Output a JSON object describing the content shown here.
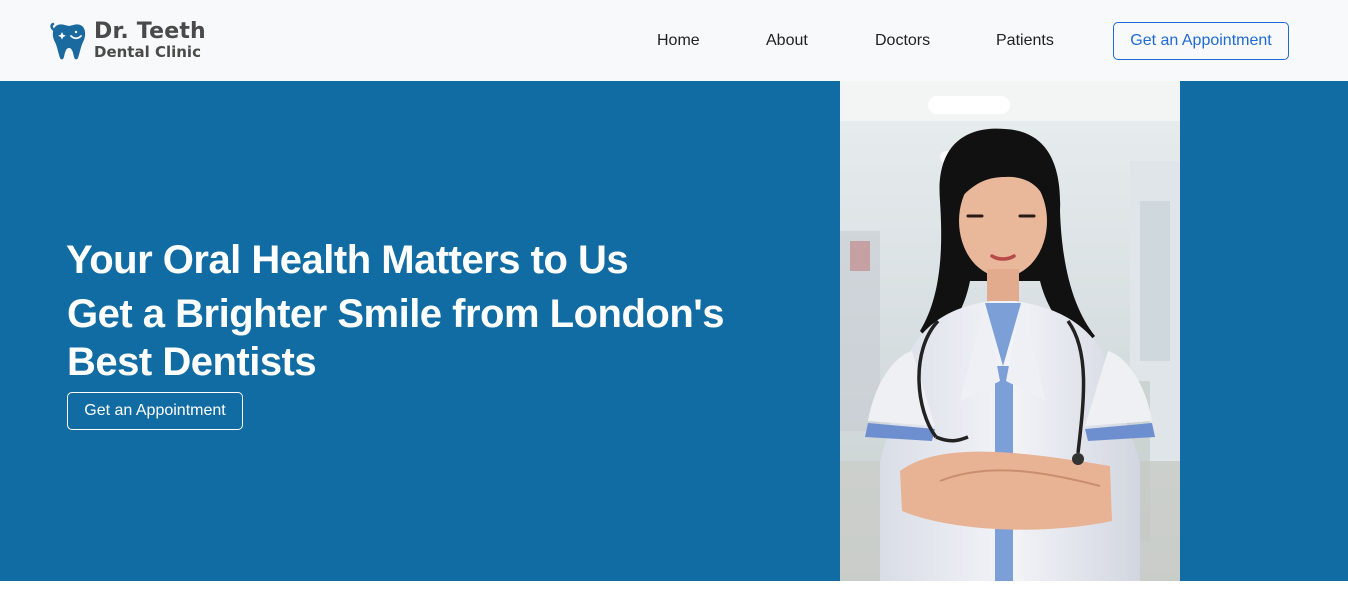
{
  "brand": {
    "title": "Dr. Teeth",
    "subtitle": "Dental Clinic",
    "icon": "tooth-icon",
    "color": "#1a6aa0"
  },
  "nav": {
    "items": [
      {
        "label": "Home"
      },
      {
        "label": "About"
      },
      {
        "label": "Doctors"
      },
      {
        "label": "Patients"
      }
    ],
    "cta_label": "Get an Appointment",
    "cta_color": "#1f6ad6"
  },
  "hero": {
    "heading": "Your Oral Health Matters to Us",
    "subheading": "Get a Brighter Smile from London's Best Dentists",
    "cta_label": "Get an Appointment",
    "background": "#116ca3",
    "image": "doctor-portrait"
  }
}
